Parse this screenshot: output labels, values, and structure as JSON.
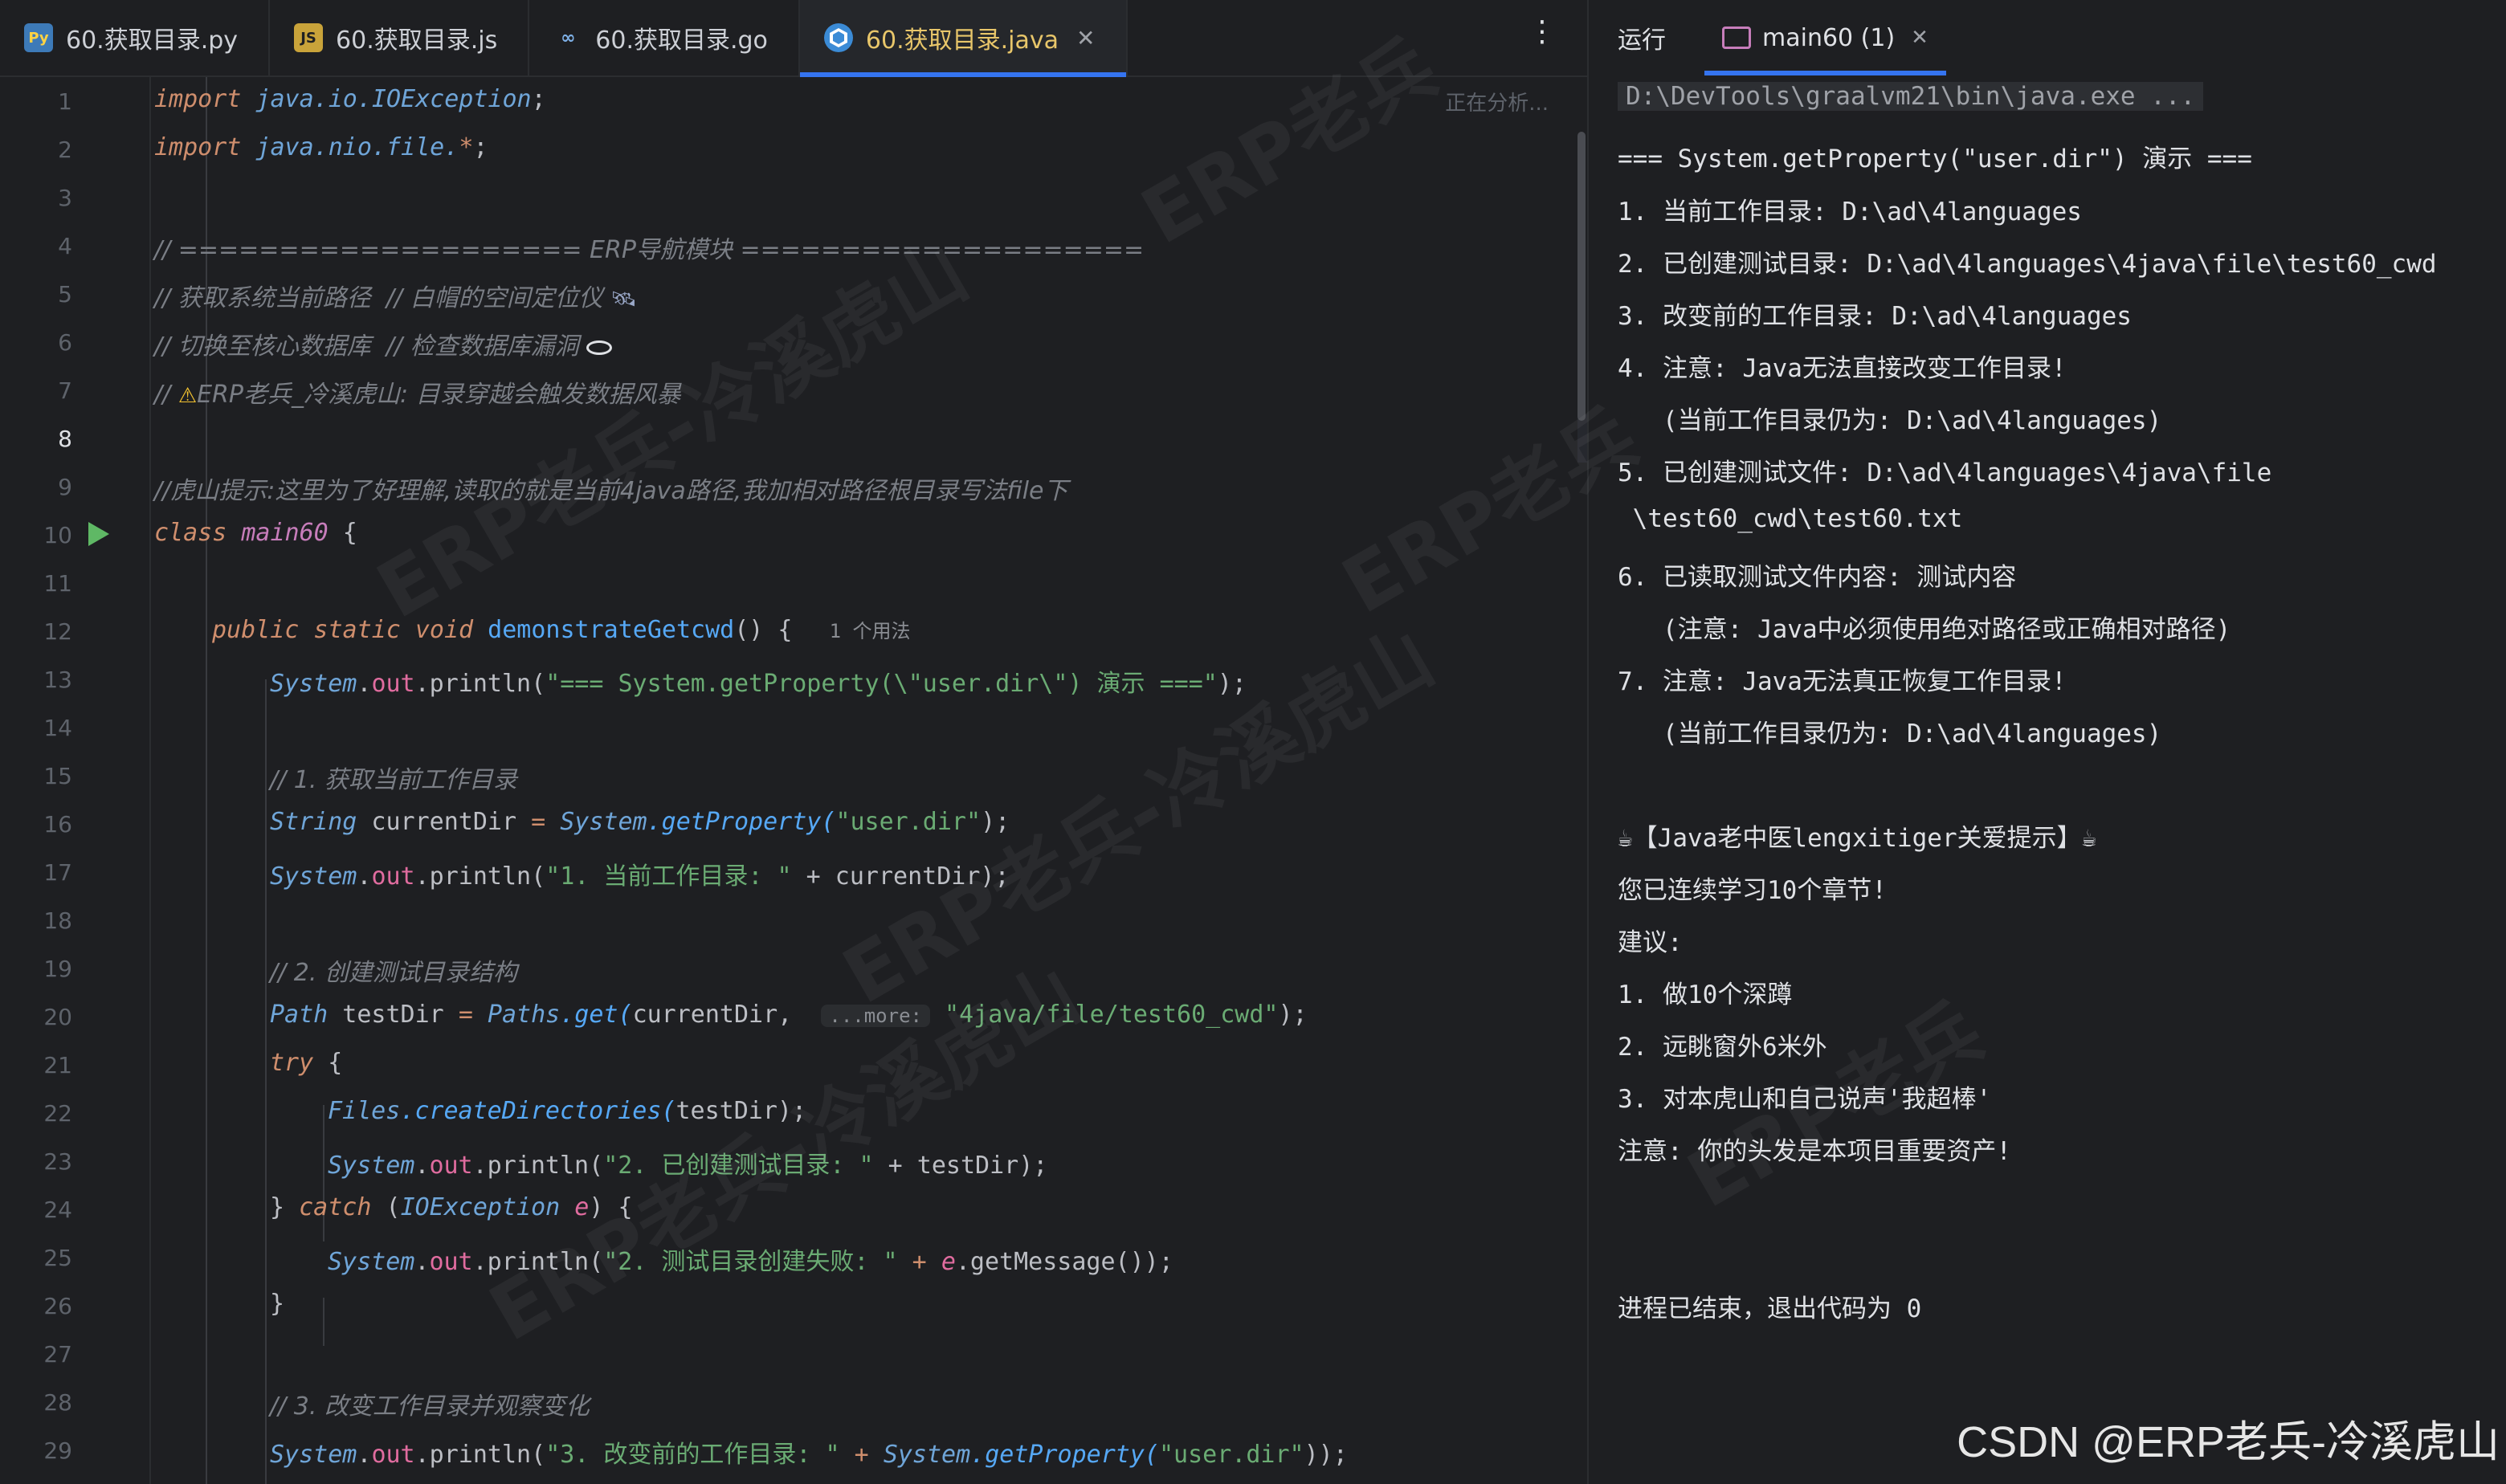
{
  "editor_tabs": [
    {
      "label": "60.获取目录.py",
      "icon": "python-file-icon"
    },
    {
      "label": "60.获取目录.js",
      "icon": "js-file-icon"
    },
    {
      "label": "60.获取目录.go",
      "icon": "go-file-icon"
    },
    {
      "label": "60.获取目录.java",
      "icon": "java-file-icon",
      "active": true
    }
  ],
  "editor": {
    "analyzing": "正在分析...",
    "current_line": 8,
    "line_numbers": [
      "1",
      "2",
      "3",
      "4",
      "5",
      "6",
      "7",
      "8",
      "9",
      "10",
      "11",
      "12",
      "13",
      "14",
      "15",
      "16",
      "17",
      "18",
      "19",
      "20",
      "21",
      "22",
      "23",
      "24",
      "25",
      "26",
      "27",
      "28",
      "29"
    ],
    "code": {
      "l1_kw": "import",
      "l1_pkg": " java.io.IOException",
      "l1_end": ";",
      "l2_kw": "import",
      "l2_pkg": " java.nio.file.",
      "l2_star": "*",
      "l2_end": ";",
      "l4": "// ==================== ERP导航模块 ====================",
      "l5": "// 获取系统当前路径  // 白帽的空间定位仪 ",
      "l6": "// 切换至核心数据库  // 检查数据库漏洞 ",
      "l7a": "// ",
      "l7b": "ERP老兵_冷溪虎山: 目录穿越会触发数据风暴",
      "l9": "//虎山提示:这里为了好理解,读取的就是当前4java路径,我加相对路径根目录写法file下",
      "l10_kw": "class",
      "l10_name": " main60",
      "l10_end": " {",
      "l12_kw": "public static void",
      "l12_fn": " demonstrateGetcwd",
      "l12_end": "() {  ",
      "l12_hint": "1 个用法",
      "l13_a": "System",
      "l13_b": ".",
      "l13_c": "out",
      "l13_d": ".println(",
      "l13_s": "\"=== System.getProperty(\\\"user.dir\\\") 演示 ===\"",
      "l13_e": ");",
      "l15": "// 1. 获取当前工作目录",
      "l16_t": "String",
      "l16_v": " currentDir ",
      "l16_eq": "= ",
      "l16_c": "System",
      "l16_m": ".getProperty(",
      "l16_s": "\"user.dir\"",
      "l16_e": ");",
      "l17_a": "System",
      "l17_c": "out",
      "l17_d": ".println(",
      "l17_s": "\"1. 当前工作目录: \"",
      "l17_p": " + currentDir);",
      "l19": "// 2. 创建测试目录结构",
      "l20_t": "Path",
      "l20_v": " testDir ",
      "l20_eq": "= ",
      "l20_c": "Paths",
      "l20_m": ".get(",
      "l20_arg": "currentDir,  ",
      "l20_hint": "...more:",
      "l20_s": " \"4java/file/test60_cwd\"",
      "l20_e": ");",
      "l21_kw": "try",
      "l21_e": " {",
      "l22_c": "Files",
      "l22_m": ".createDirectories(",
      "l22_e": "testDir);",
      "l23_a": "System",
      "l23_c": "out",
      "l23_d": ".println(",
      "l23_s": "\"2. 已创建测试目录: \"",
      "l23_p": " + testDir);",
      "l24_a": "} ",
      "l24_kw": "catch",
      "l24_b": " (",
      "l24_t": "IOException",
      "l24_v": " e",
      "l24_e": ") {",
      "l25_a": "System",
      "l25_c": "out",
      "l25_d": ".println(",
      "l25_s": "\"2. 测试目录创建失败: \"",
      "l25_p": " + ",
      "l25_v": "e",
      "l25_m": ".getMessage());",
      "l26": "}",
      "l28": "// 3. 改变工作目录并观察变化",
      "l29_a": "System",
      "l29_c": "out",
      "l29_d": ".println(",
      "l29_s": "\"3. 改变前的工作目录: \"",
      "l29_p": " + ",
      "l29_c2": "System",
      "l29_m": ".getProperty(",
      "l29_s2": "\"user.dir\"",
      "l29_e": "));"
    }
  },
  "run_panel": {
    "label": "运行",
    "tab": "main60 (1)",
    "output": [
      "D:\\DevTools\\graalvm21\\bin\\java.exe ...",
      "=== System.getProperty(\"user.dir\") 演示 ===",
      "1. 当前工作目录: D:\\ad\\4languages",
      "2. 已创建测试目录: D:\\ad\\4languages\\4java\\file\\test60_cwd",
      "3. 改变前的工作目录: D:\\ad\\4languages",
      "4. 注意: Java无法直接改变工作目录!",
      "   (当前工作目录仍为: D:\\ad\\4languages)",
      "5. 已创建测试文件: D:\\ad\\4languages\\4java\\file",
      " \\test60_cwd\\test60.txt",
      "6. 已读取测试文件内容: 测试内容",
      "   (注意: Java中必须使用绝对路径或正确相对路径)",
      "7. 注意: Java无法真正恢复工作目录!",
      "   (当前工作目录仍为: D:\\ad\\4languages)",
      "☕【Java老中医lengxitiger关爱提示】☕",
      "您已连续学习10个章节!",
      "建议:",
      "1. 做10个深蹲",
      "2. 远眺窗外6米外",
      "3. 对本虎山和自己说声'我超棒'",
      "注意: 你的头发是本项目重要资产!",
      "进程已结束，退出代码为 0"
    ]
  },
  "watermark": {
    "text_a": "ERP老兵-冷溪虎山",
    "text_b": "ERP老兵",
    "csdn": "CSDN @ERP老兵-冷溪虎山"
  }
}
